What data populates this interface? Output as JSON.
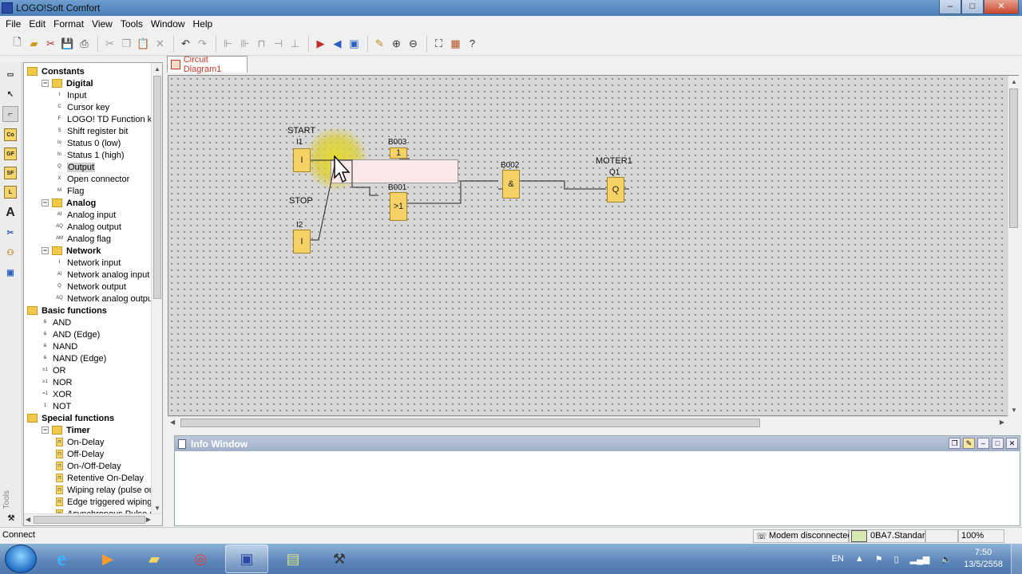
{
  "window": {
    "title": "LOGO!Soft Comfort",
    "buttons": [
      "–",
      "□",
      "✕"
    ]
  },
  "menu": [
    "File",
    "Edit",
    "Format",
    "View",
    "Tools",
    "Window",
    "Help"
  ],
  "toolbar": {
    "items": [
      "new-file-icon",
      "open-icon",
      "cut-icon",
      "save-icon",
      "print-icon",
      "scissors-icon",
      "copy-icon",
      "paste-icon",
      "delete-icon",
      "undo-icon",
      "redo-icon",
      "align-left-icon",
      "align-center-icon",
      "align-top-icon",
      "align-middle-icon",
      "align-bottom-icon",
      "pc-to-logo-icon",
      "logo-to-pc-icon",
      "simulation-icon",
      "pen-icon",
      "zoom-in-icon",
      "zoom-out-icon",
      "fit-icon",
      "grid-icon",
      "help-icon"
    ]
  },
  "tools_label": "Tools",
  "tab": {
    "label": "Circuit Diagram1"
  },
  "tree": [
    {
      "label": "Constants",
      "level": 0,
      "bold": true,
      "kind": "folder",
      "exp": "−"
    },
    {
      "label": "Digital",
      "level": 1,
      "bold": true,
      "kind": "folder",
      "exp": "−"
    },
    {
      "label": "Input",
      "level": 2,
      "ico": "I"
    },
    {
      "label": "Cursor key",
      "level": 2,
      "ico": "C"
    },
    {
      "label": "LOGO! TD Function key",
      "level": 2,
      "ico": "F"
    },
    {
      "label": "Shift register bit",
      "level": 2,
      "ico": "S"
    },
    {
      "label": "Status 0 (low)",
      "level": 2,
      "ico": "lo"
    },
    {
      "label": "Status 1 (high)",
      "level": 2,
      "ico": "hi"
    },
    {
      "label": "Output",
      "level": 2,
      "ico": "Q",
      "selected": true
    },
    {
      "label": "Open connector",
      "level": 2,
      "ico": "X"
    },
    {
      "label": "Flag",
      "level": 2,
      "ico": "M"
    },
    {
      "label": "Analog",
      "level": 1,
      "bold": true,
      "kind": "folder",
      "exp": "−"
    },
    {
      "label": "Analog input",
      "level": 2,
      "ico": "AI"
    },
    {
      "label": "Analog output",
      "level": 2,
      "ico": "AQ"
    },
    {
      "label": "Analog flag",
      "level": 2,
      "ico": "AM"
    },
    {
      "label": "Network",
      "level": 1,
      "bold": true,
      "kind": "folder",
      "exp": "−"
    },
    {
      "label": "Network input",
      "level": 2,
      "ico": "I"
    },
    {
      "label": "Network analog input",
      "level": 2,
      "ico": "AI"
    },
    {
      "label": "Network output",
      "level": 2,
      "ico": "Q"
    },
    {
      "label": "Network analog output",
      "level": 2,
      "ico": "AQ"
    },
    {
      "label": "Basic functions",
      "level": 0,
      "bold": true,
      "kind": "folder",
      "exp": "−"
    },
    {
      "label": "AND",
      "level": 1,
      "ico": "&"
    },
    {
      "label": "AND (Edge)",
      "level": 1,
      "ico": "&"
    },
    {
      "label": "NAND",
      "level": 1,
      "ico": "&"
    },
    {
      "label": "NAND (Edge)",
      "level": 1,
      "ico": "&"
    },
    {
      "label": "OR",
      "level": 1,
      "ico": "≥1"
    },
    {
      "label": "NOR",
      "level": 1,
      "ico": "≥1"
    },
    {
      "label": "XOR",
      "level": 1,
      "ico": "=1"
    },
    {
      "label": "NOT",
      "level": 1,
      "ico": "1"
    },
    {
      "label": "Special functions",
      "level": 0,
      "bold": true,
      "kind": "folder",
      "exp": "−"
    },
    {
      "label": "Timer",
      "level": 1,
      "bold": true,
      "kind": "folder",
      "exp": "−"
    },
    {
      "label": "On-Delay",
      "level": 2,
      "ico": "⊓",
      "yellow": true
    },
    {
      "label": "Off-Delay",
      "level": 2,
      "ico": "⊓",
      "yellow": true
    },
    {
      "label": "On-/Off-Delay",
      "level": 2,
      "ico": "⊓",
      "yellow": true
    },
    {
      "label": "Retentive On-Delay",
      "level": 2,
      "ico": "⊓",
      "yellow": true
    },
    {
      "label": "Wiping relay (pulse outp",
      "level": 2,
      "ico": "⊓",
      "yellow": true
    },
    {
      "label": "Edge triggered wiping re",
      "level": 2,
      "ico": "⊓",
      "yellow": true
    },
    {
      "label": "Asynchronous Pulse Ge",
      "level": 2,
      "ico": "⊓",
      "yellow": true
    }
  ],
  "diagram": {
    "labels": {
      "start": "START",
      "stop": "STOP",
      "moter": "MOTER1"
    },
    "blocks": {
      "i1": {
        "name": "I1",
        "sym": "I"
      },
      "i2": {
        "name": "I2",
        "sym": "I"
      },
      "b003": {
        "name": "B003",
        "sym": "1"
      },
      "b001": {
        "name": "B001",
        "sym": ">1"
      },
      "b002": {
        "name": "B002",
        "sym": "&"
      },
      "q1": {
        "name": "Q1",
        "sym": "Q"
      }
    },
    "block_color": "#f5d166"
  },
  "info": {
    "title": "Info Window"
  },
  "status": {
    "left": "Connect",
    "modem": "Modem disconnected",
    "device": "0BA7.Standard",
    "zoom": "100%"
  },
  "taskbar": {
    "apps": [
      "ie-icon",
      "media-player-icon",
      "explorer-icon",
      "app-swirl-icon",
      "logo-soft-icon",
      "notes-icon",
      "tools-icon"
    ],
    "lang": "EN",
    "time": "7:50",
    "date": "13/5/2558"
  }
}
